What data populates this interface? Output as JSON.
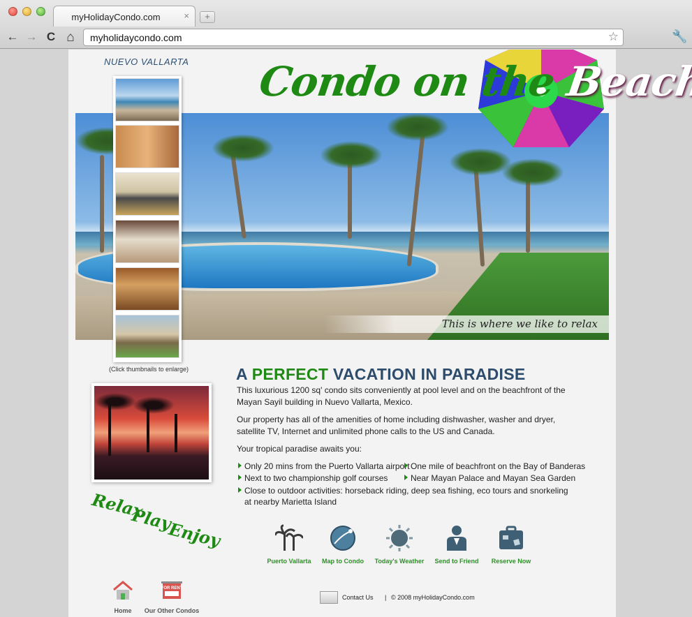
{
  "browser": {
    "tab_title": "myHolidayCondo.com",
    "tab_close": "×",
    "new_tab": "+",
    "url": "myholidaycondo.com",
    "back_icon": "←",
    "forward_icon": "→",
    "reload_icon": "C",
    "home_icon": "⌂",
    "star_icon": "☆",
    "wrench_icon": "🔧"
  },
  "page": {
    "location": "NUEVO VALLARTA",
    "title_part1": "Condo on the ",
    "title_part2": "Beach",
    "hero_caption": "This is where we like to relax",
    "thumbs_note": "(Click thumbnails to enlarge)",
    "slogan": [
      "Relax",
      "Play",
      "Enjoy"
    ],
    "headline_pre": "A ",
    "headline_accent": "PERFECT",
    "headline_post": " VACATION IN PARADISE",
    "paragraphs": [
      "This luxurious 1200 sq' condo sits conveniently at pool level and on the beachfront of the Mayan Sayil building in Nuevo Vallarta, Mexico.",
      "Our property has all of the amenities of home including dishwasher, washer and dryer, satellite TV, Internet and unlimited phone calls to the US and Canada.",
      "Your tropical paradise awaits you:"
    ],
    "bullets": [
      "Only 20 mins from the Puerto Vallarta airport",
      "One mile of beachfront on the Bay of Banderas",
      "Next to two championship golf courses",
      "Near Mayan Palace and Mayan Sea Garden",
      "Close to outdoor activities: horseback riding, deep sea fishing, eco tours and snorkeling at nearby Marietta Island"
    ],
    "nav_icons": [
      "Puerto Vallarta",
      "Map to Condo",
      "Today's Weather",
      "Send to Friend",
      "Reserve Now"
    ],
    "footer_icons": [
      "Home",
      "Our Other Condos"
    ],
    "for_rent_sign": "FOR RENT",
    "contact": "Contact Us",
    "separator": "|",
    "copyright": "© 2008 myHolidayCondo.com"
  },
  "colors": {
    "brand_green": "#1e8a14",
    "headline_blue": "#2d4c6c",
    "nav_label_green": "#2f8f2a"
  }
}
